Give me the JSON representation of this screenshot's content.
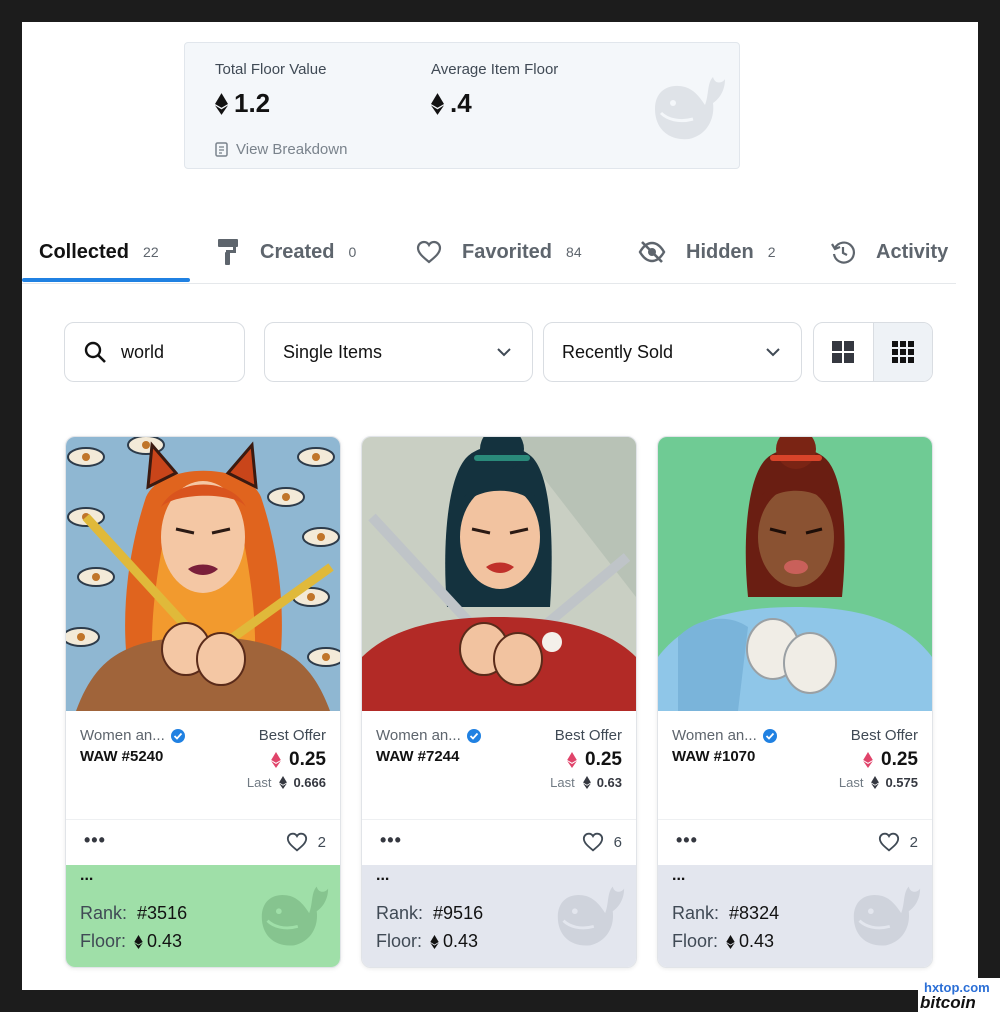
{
  "summary": {
    "total_floor_label": "Total Floor Value",
    "total_floor_value": "1.2",
    "avg_floor_label": "Average Item Floor",
    "avg_floor_value": ".4",
    "breakdown_label": "View Breakdown"
  },
  "tabs": [
    {
      "label": "Collected",
      "count": "22",
      "icon": "collected",
      "active": true
    },
    {
      "label": "Created",
      "count": "0",
      "icon": "paint-roller-icon"
    },
    {
      "label": "Favorited",
      "count": "84",
      "icon": "heart-icon"
    },
    {
      "label": "Hidden",
      "count": "2",
      "icon": "eye-slash-icon"
    },
    {
      "label": "Activity",
      "count": "",
      "icon": "history-icon"
    }
  ],
  "filters": {
    "search_value": "world",
    "item_type": "Single Items",
    "sort": "Recently Sold"
  },
  "items": [
    {
      "collection": "Women an...",
      "token": "WAW #5240",
      "offer_label": "Best Offer",
      "offer": "0.25",
      "last_label": "Last",
      "last": "0.666",
      "likes": "2",
      "rank_label": "Rank:",
      "rank": "#3516",
      "floor_label": "Floor:",
      "floor": "0.43",
      "panel_color": "#9fdfa8"
    },
    {
      "collection": "Women an...",
      "token": "WAW #7244",
      "offer_label": "Best Offer",
      "offer": "0.25",
      "last_label": "Last",
      "last": "0.63",
      "likes": "6",
      "rank_label": "Rank:",
      "rank": "#9516",
      "floor_label": "Floor:",
      "floor": "0.43",
      "panel_color": "#e3e6ee"
    },
    {
      "collection": "Women an...",
      "token": "WAW #1070",
      "offer_label": "Best Offer",
      "offer": "0.25",
      "last_label": "Last",
      "last": "0.575",
      "likes": "2",
      "rank_label": "Rank:",
      "rank": "#8324",
      "floor_label": "Floor:",
      "floor": "0.43",
      "panel_color": "#e3e6ee"
    }
  ],
  "colors": {
    "accent": "#2081e2",
    "verified": "#2081e2",
    "eth_offer": "#e0446a"
  },
  "watermark": {
    "line1": "hxtop.com",
    "line2": "bitcoin"
  }
}
